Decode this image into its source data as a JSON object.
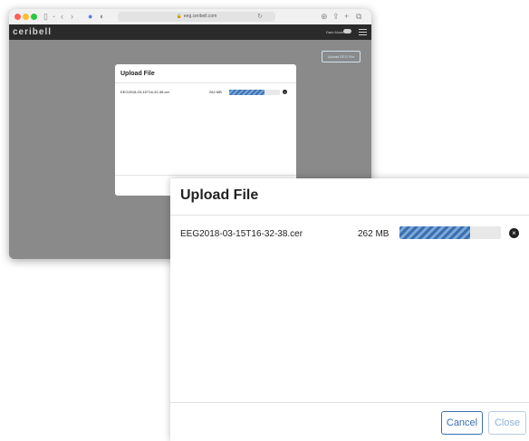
{
  "browser": {
    "url": "eeg.ceribell.com",
    "traffic_lights": [
      "#ff5f57",
      "#febc2e",
      "#28c840"
    ]
  },
  "app": {
    "logo": "ceribell",
    "dark_mode_label": "Dark Mode",
    "upload_eeg_label": "Upload EEG File"
  },
  "modal": {
    "title": "Upload File",
    "file": {
      "name": "EEG2018-03-15T16-32-38.cer",
      "size": "262 MB",
      "progress_percent": 70
    },
    "cancel_label": "Cancel",
    "close_label": "Close"
  },
  "colors": {
    "accent": "#3a70b0",
    "overlay": "#8a8a8a",
    "appbar": "#2b2b2b"
  }
}
